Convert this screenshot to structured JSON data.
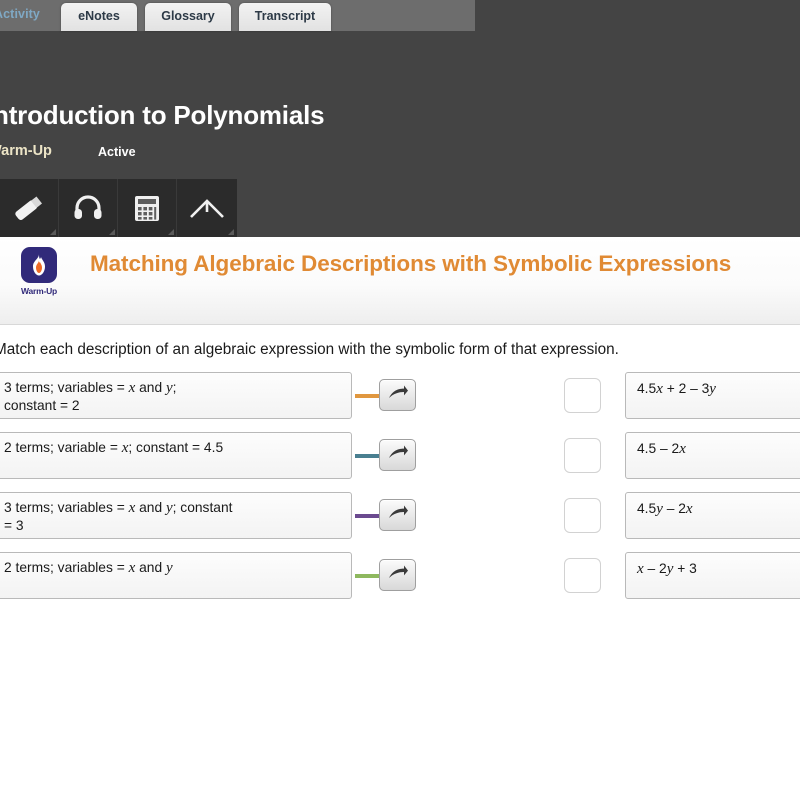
{
  "tabs": [
    {
      "label": "Activity",
      "name": "tab-activity",
      "active": true
    },
    {
      "label": "eNotes",
      "name": "tab-enotes",
      "active": false
    },
    {
      "label": "Glossary",
      "name": "tab-glossary",
      "active": false
    },
    {
      "label": "Transcript",
      "name": "tab-transcript",
      "active": false
    }
  ],
  "lesson": {
    "title": "Introduction to Polynomials",
    "phase": "Warm-Up",
    "state": "Active"
  },
  "toolbar": {
    "items": [
      {
        "icon": "highlighter-icon"
      },
      {
        "icon": "headphones-icon"
      },
      {
        "icon": "calculator-icon"
      },
      {
        "icon": "protractor-icon"
      }
    ]
  },
  "activity": {
    "badge_label": "Warm-Up",
    "badge_icon": "flame-icon",
    "title": "Matching Algebraic Descriptions with Symbolic Expressions",
    "instruction": "Match each description of an algebraic expression with the symbolic form of that expression.",
    "title_color": "#e08a34",
    "badge_color": "#312a7a"
  },
  "matching": {
    "rows": [
      {
        "description_html": "3 terms; variables = <i>x</i> and <i>y</i>;<br>constant = 2",
        "connector_color": "#e0973f",
        "arrow_icon": "curved-arrow-right-icon",
        "drop_value": "",
        "expression_html": "4.5<i>x</i> + 2 &#8211; 3<i>y</i>"
      },
      {
        "description_html": "2 terms; variable = <i>x</i>; constant = 4.5",
        "connector_color": "#497f90",
        "arrow_icon": "curved-arrow-right-icon",
        "drop_value": "",
        "expression_html": "4.5 &#8211; 2<i>x</i>"
      },
      {
        "description_html": "3 terms; variables = <i>x</i> and <i>y</i>; constant<br>= 3",
        "connector_color": "#6b4a8f",
        "arrow_icon": "curved-arrow-right-icon",
        "drop_value": "",
        "expression_html": "4.5<i>y</i> &#8211; 2<i>x</i>"
      },
      {
        "description_html": "2 terms; variables = <i>x</i> and <i>y</i>",
        "connector_color": "#8eb85f",
        "arrow_icon": "curved-arrow-right-icon",
        "drop_value": "",
        "expression_html": "<i>x</i> &#8211; 2<i>y</i> + 3"
      }
    ]
  }
}
